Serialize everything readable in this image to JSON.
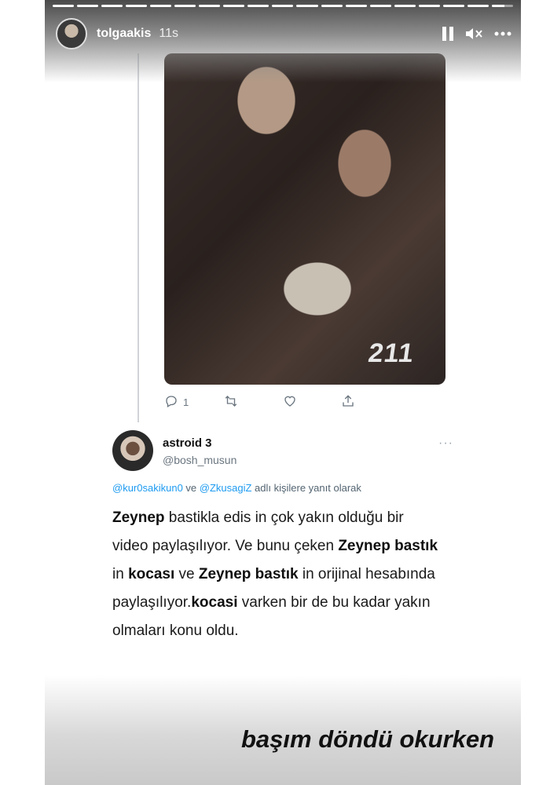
{
  "story": {
    "username": "tolgaakis",
    "time": "11s",
    "progress_segments": [
      1,
      1,
      1,
      1,
      1,
      1,
      1,
      1,
      1,
      1,
      1,
      1,
      1,
      1,
      1,
      1,
      1,
      1,
      0.6
    ],
    "caption": "başım döndü okurken"
  },
  "tweet1": {
    "photo_overlay_text": "211",
    "reply_count": "1"
  },
  "tweet2": {
    "name": "astroid 3",
    "handle": "@bosh_musun",
    "more_label": "···",
    "reply_to": {
      "mention1": "@kur0sakikun0",
      "connector": " ve ",
      "mention2": "@ZkusagiZ",
      "suffix": " adlı kişilere yanıt olarak"
    },
    "body": {
      "p1_b1": "Zeynep",
      "p1_t1": " bastikla edis in çok yakın olduğu bir video paylaşılıyor. Ve bunu çeken ",
      "p1_b2": "Zeynep bastık",
      "p1_t2": " in ",
      "p1_b3": "kocası",
      "p1_t3": " ve ",
      "p1_b4": "Zeynep bastık",
      "p1_t4": " in orijinal hesabında paylaşılıyor.",
      "p1_b5": "kocasi",
      "p1_t5": " varken bir de bu kadar yakın olmaları konu oldu."
    }
  },
  "icons": {
    "pause": "pause-icon",
    "mute": "speaker-muted-icon",
    "more": "more-icon",
    "reply": "reply-icon",
    "retweet": "retweet-icon",
    "like": "heart-icon",
    "share": "share-icon"
  }
}
